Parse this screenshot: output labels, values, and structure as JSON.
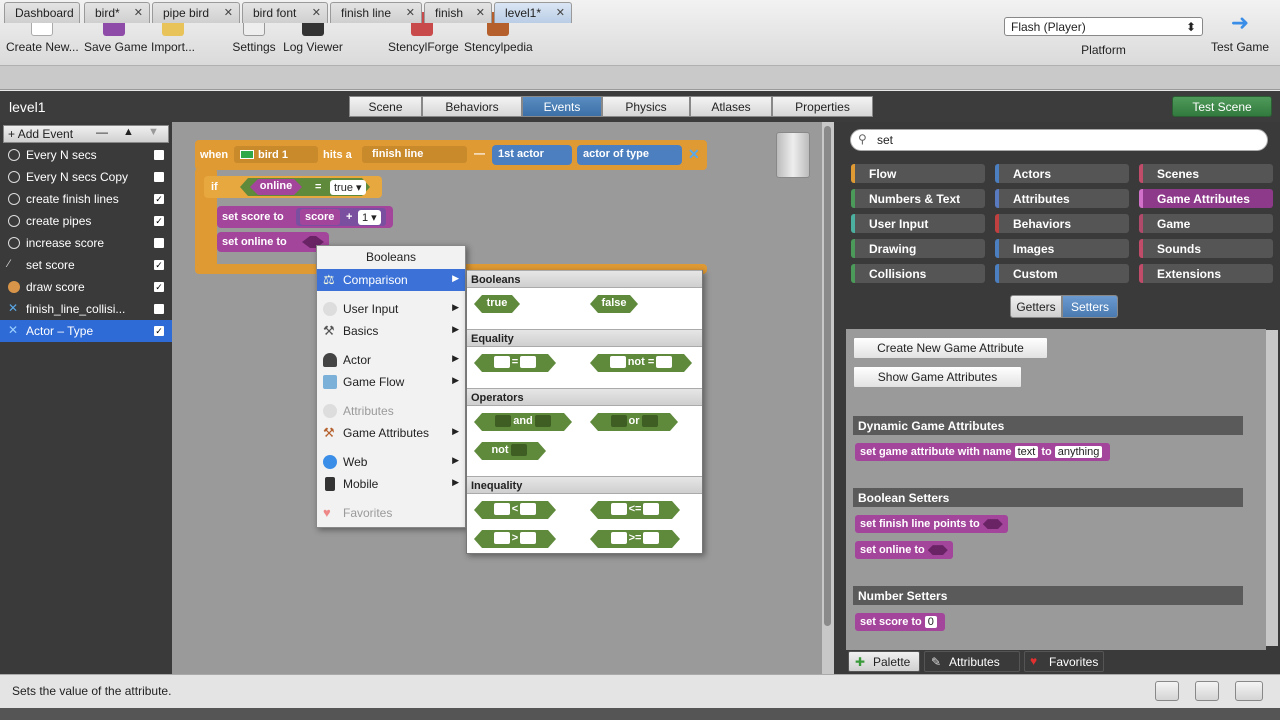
{
  "toolbar": {
    "create": "Create New...",
    "save": "Save Game",
    "import": "Import...",
    "settings": "Settings",
    "log": "Log Viewer",
    "forge": "StencylForge",
    "pedia": "Stencylpedia",
    "platform_value": "Flash (Player)",
    "platform_label": "Platform",
    "test_game": "Test Game"
  },
  "tabs": [
    "Dashboard",
    "bird*",
    "pipe bird",
    "bird font",
    "finish line",
    "finish",
    "level1*"
  ],
  "header": {
    "title": "level1",
    "segments": [
      "Scene",
      "Behaviors",
      "Events",
      "Physics",
      "Atlases",
      "Properties"
    ],
    "test_scene": "Test Scene"
  },
  "events": {
    "add": "Add Event",
    "items": [
      "Every N secs",
      "Every N secs Copy",
      "create finish lines",
      "create pipes",
      "increase score",
      "set score",
      "draw score",
      "finish_line_collisi...",
      "Actor – Type"
    ]
  },
  "blocks": {
    "when": "when",
    "actor": "bird 1",
    "hits": "hits a",
    "target": "finish line",
    "dash": "—",
    "first": "1st actor",
    "type_of": "actor of type",
    "if": "if",
    "online": "online",
    "eq": "=",
    "true_val": "true",
    "set_score": "set score to",
    "score": "score",
    "plus": "+",
    "one": "1",
    "set_online": "set online to"
  },
  "menu": {
    "header": "Booleans",
    "items": [
      "Comparison",
      "User Input",
      "Basics",
      "Actor",
      "Game Flow",
      "Attributes",
      "Game Attributes",
      "Web",
      "Mobile",
      "Favorites"
    ]
  },
  "submenu": {
    "sections": [
      "Booleans",
      "Equality",
      "Operators",
      "Inequality"
    ],
    "true": "true",
    "false": "false",
    "eq": "=",
    "neq": "not =",
    "and": "and",
    "or": "or",
    "not": "not",
    "lt": "<",
    "lte": "<=",
    "gt": ">",
    "gte": ">="
  },
  "right": {
    "search": "set",
    "categories": [
      "Flow",
      "Actors",
      "Scenes",
      "Numbers & Text",
      "Attributes",
      "Game Attributes",
      "User Input",
      "Behaviors",
      "Game",
      "Drawing",
      "Images",
      "Sounds",
      "Collisions",
      "Custom",
      "Extensions"
    ],
    "getters": "Getters",
    "setters": "Setters",
    "create_btn": "Create New Game Attribute",
    "show_btn": "Show Game Attributes",
    "dyn_header": "Dynamic Game Attributes",
    "dyn_block": "set game attribute with name",
    "dyn_text": "text",
    "dyn_to": "to",
    "dyn_any": "anything",
    "bool_header": "Boolean Setters",
    "b1": "set finish line points to",
    "b2": "set online to",
    "num_header": "Number Setters",
    "n1": "set score to",
    "n1v": "0",
    "tabs": [
      "Palette",
      "Attributes",
      "Favorites"
    ]
  },
  "status": "Sets the value of the attribute."
}
